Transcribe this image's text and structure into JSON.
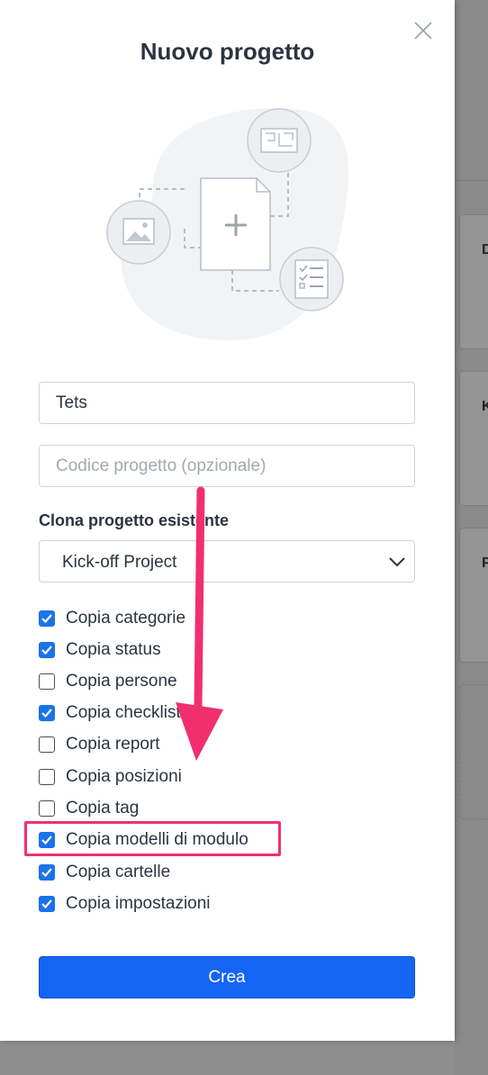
{
  "modal": {
    "title": "Nuovo progetto",
    "close_icon": "close-icon"
  },
  "form": {
    "project_name": {
      "value": "Tets",
      "placeholder": ""
    },
    "project_code": {
      "value": "",
      "placeholder": "Codice progetto (opzionale)"
    },
    "clone_label": "Clona progetto esistente",
    "clone_select": {
      "value": "Kick-off Project",
      "icon": "chevron-down-icon"
    },
    "options": [
      {
        "label": "Copia categorie",
        "checked": true
      },
      {
        "label": "Copia status",
        "checked": true
      },
      {
        "label": "Copia persone",
        "checked": false
      },
      {
        "label": "Copia checklist",
        "checked": true
      },
      {
        "label": "Copia report",
        "checked": false
      },
      {
        "label": "Copia posizioni",
        "checked": false
      },
      {
        "label": "Copia tag",
        "checked": false
      },
      {
        "label": "Copia modelli di modulo",
        "checked": true
      },
      {
        "label": "Copia cartelle",
        "checked": true
      },
      {
        "label": "Copia impostazioni",
        "checked": true
      }
    ],
    "submit_label": "Crea"
  },
  "background": {
    "cards": [
      "D",
      "K",
      "P"
    ]
  },
  "colors": {
    "accent": "#1565f5",
    "checkbox": "#1a73e8",
    "annotation": "#f0306e",
    "text": "#2c3340"
  }
}
